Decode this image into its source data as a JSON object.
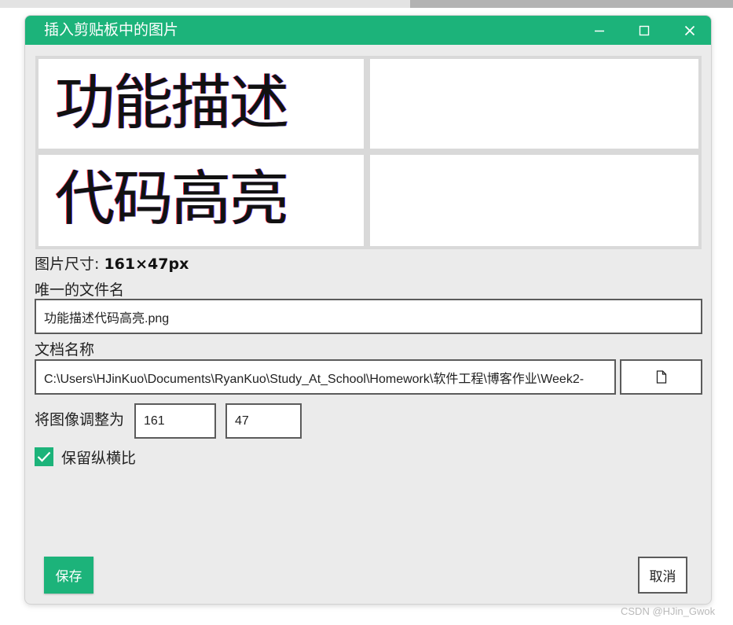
{
  "window": {
    "title": "插入剪贴板中的图片",
    "controls": [
      "minimize-icon",
      "maximize-icon",
      "close-icon"
    ]
  },
  "preview": {
    "row1": "功能描述",
    "row2": "代码高亮"
  },
  "image_size": {
    "label": "图片尺寸:",
    "value": "161×47px"
  },
  "filename": {
    "label": "唯一的文件名",
    "value": "功能描述代码高亮.png"
  },
  "docname": {
    "label": "文档名称",
    "value": "C:\\Users\\HJinKuo\\Documents\\RyanKuo\\Study_At_School\\Homework\\软件工程\\博客作业\\Week2-",
    "browse_icon": "file-icon"
  },
  "resize": {
    "label": "将图像调整为",
    "width": "161",
    "height": "47"
  },
  "aspect": {
    "label": "保留纵横比",
    "checked": true
  },
  "buttons": {
    "save": "保存",
    "cancel": "取消"
  },
  "watermark": "CSDN @HJin_Gwok",
  "colors": {
    "accent": "#1cb37a",
    "dialog_bg": "#ebebeb"
  }
}
